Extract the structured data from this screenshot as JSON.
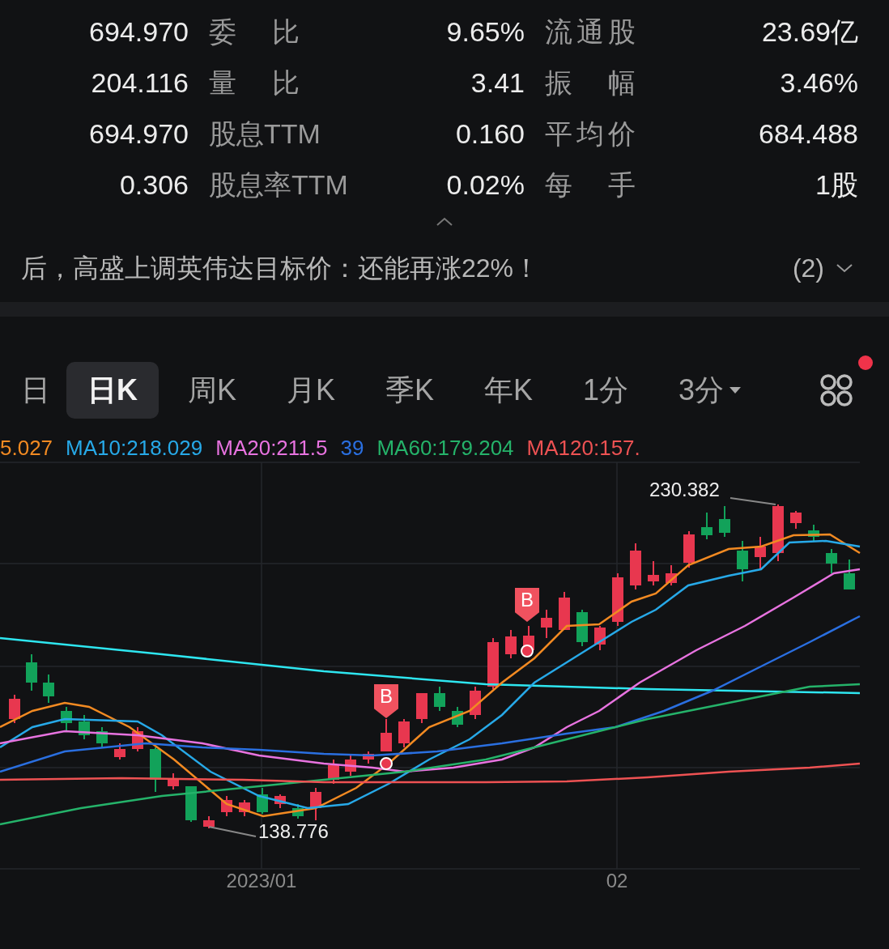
{
  "stats": [
    {
      "cells": [
        "694.970",
        "委 比",
        "9.65%",
        "流通股",
        "23.69亿"
      ]
    },
    {
      "cells": [
        "204.116",
        "量 比",
        "3.41",
        "振 幅",
        "3.46%"
      ]
    },
    {
      "cells": [
        "694.970",
        "股息TTM",
        "0.160",
        "平均价",
        "684.488"
      ]
    },
    {
      "cells": [
        "0.306",
        "股息率TTM",
        "0.02%",
        "每 手",
        "1股"
      ]
    }
  ],
  "news": {
    "headline": "后，高盛上调英伟达目标价：还能再涨22%！",
    "count": "(2)"
  },
  "tabs": [
    {
      "label": "日",
      "selected": false
    },
    {
      "label": "日K",
      "selected": true
    },
    {
      "label": "周K",
      "selected": false
    },
    {
      "label": "月K",
      "selected": false
    },
    {
      "label": "季K",
      "selected": false
    },
    {
      "label": "年K",
      "selected": false
    },
    {
      "label": "1分",
      "selected": false
    },
    {
      "label": "3分",
      "selected": false,
      "kind": "dropdown"
    }
  ],
  "layout_button": {
    "notification": true
  },
  "legend": [
    {
      "text": "5.027",
      "color": "#f28a22"
    },
    {
      "text": "MA10:218.029",
      "color": "#27a9e8"
    },
    {
      "text": "MA20:211.5",
      "color": "#e873e0"
    },
    {
      "text": "39",
      "color": "#2a6fe0"
    },
    {
      "text": "MA60:179.204",
      "color": "#25b36a"
    },
    {
      "text": "MA120:157.",
      "color": "#ee5253"
    }
  ],
  "chart": {
    "low_label": "138.776",
    "high_label": "230.382",
    "markers": [
      "B",
      "B"
    ],
    "x_labels": [
      "2023/01",
      "02"
    ]
  }
}
